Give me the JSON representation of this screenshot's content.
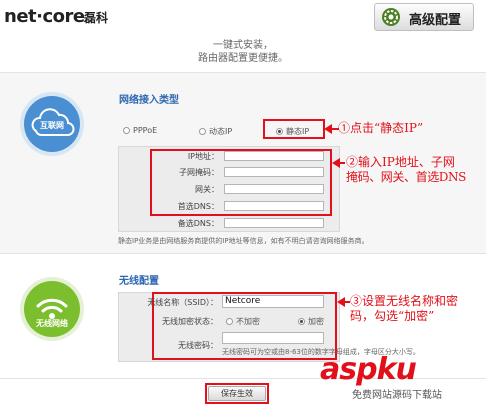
{
  "header": {
    "brand": "net·core",
    "brand_cn": "磊科",
    "advanced_button": "高级配置"
  },
  "intro": {
    "line1": "一键式安装，",
    "line2": "路由器配置更便捷。"
  },
  "network": {
    "badge": "互联网",
    "title": "网络接入类型",
    "radios": [
      {
        "label": "PPPoE",
        "selected": false
      },
      {
        "label": "动态IP",
        "selected": false
      },
      {
        "label": "静态IP",
        "selected": true
      }
    ],
    "fields": [
      {
        "label": "IP地址：",
        "value": ""
      },
      {
        "label": "子网掩码：",
        "value": ""
      },
      {
        "label": "网关：",
        "value": ""
      },
      {
        "label": "首选DNS：",
        "value": ""
      },
      {
        "label": "备选DNS：",
        "value": ""
      }
    ],
    "note": "静态IP业务是由网络服务商提供的IP地址等信息，如有不明白请咨询网络服务商。"
  },
  "wireless": {
    "badge": "无线网络",
    "title": "无线配置",
    "ssid_label": "无线名称（SSID）：",
    "ssid_value": "Netcore",
    "encrypt_label": "无线加密状态：",
    "encrypt_options": [
      {
        "label": "不加密",
        "selected": false
      },
      {
        "label": "加密",
        "selected": true
      }
    ],
    "password_label": "无线密码：",
    "password_value": "",
    "password_hint": "无线密码可为空或由8-63位的数字字母组成，字母区分大小写。"
  },
  "save_button": "保存生效",
  "annotations": {
    "a1": "①点击“静态IP”",
    "a2_line1": "②输入IP地址、子网",
    "a2_line2": "掩码、网关、首选DNS",
    "a3_line1": "③设置无线名称和密",
    "a3_line2": "码，勾选“加密”"
  },
  "watermark": {
    "main": "aspku",
    "sub": "免费网站源码下载站"
  },
  "colors": {
    "accent_blue": "#2f67b1",
    "annotation_red": "#e1101a",
    "cloud_badge": "#4a8fd1",
    "wifi_badge": "#7bbf2e"
  }
}
